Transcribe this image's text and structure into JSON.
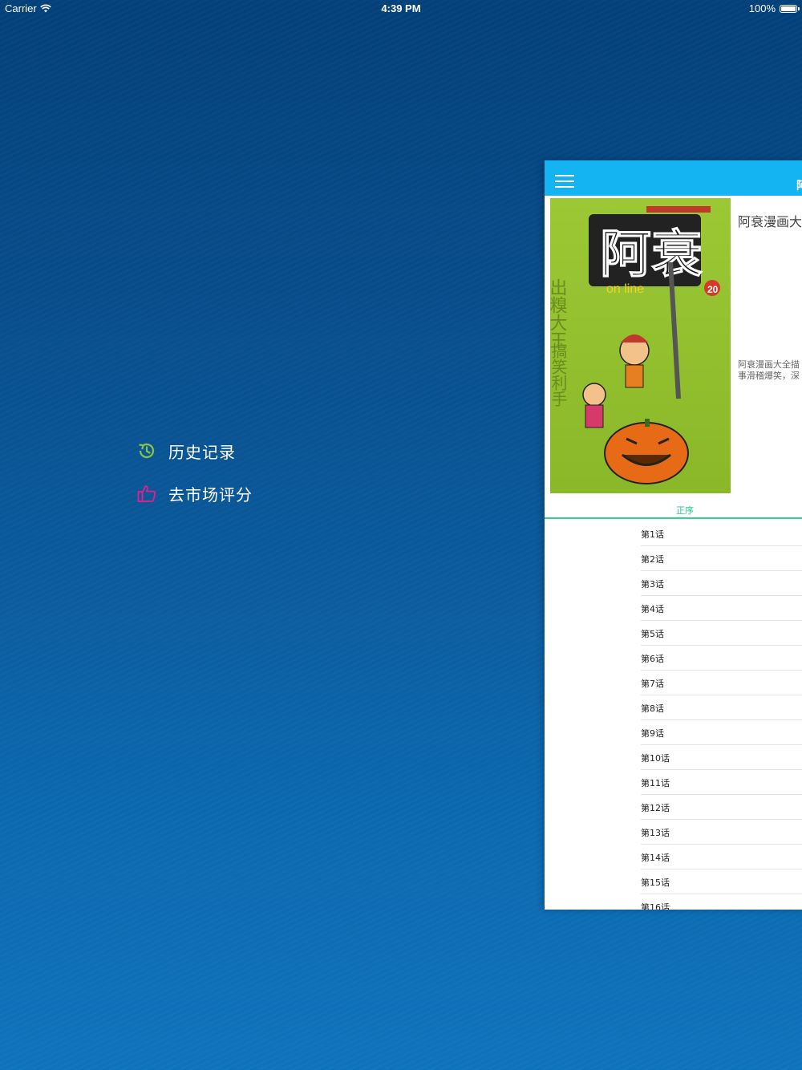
{
  "status_bar": {
    "carrier": "Carrier",
    "time": "4:39 PM",
    "battery": "100%",
    "battery_level": 1.0
  },
  "side_menu": {
    "items": [
      {
        "label": "历史记录",
        "icon": "history-icon",
        "color": "#8bc34a"
      },
      {
        "label": "去市场评分",
        "icon": "thumbs-up-icon",
        "color": "#e91e8c"
      }
    ]
  },
  "panel": {
    "nav_title": "阿",
    "info": {
      "title": "阿衰漫画大",
      "description_line1": "阿衰漫画大全描",
      "description_line2": "事滑稽爆笑，深"
    },
    "sort_label": "正序",
    "chapters": [
      "第1话",
      "第2话",
      "第3话",
      "第4话",
      "第5话",
      "第6话",
      "第7话",
      "第8话",
      "第9话",
      "第10话",
      "第11话",
      "第12话",
      "第13话",
      "第14话",
      "第15话",
      "第16话"
    ],
    "cover": {
      "title": "阿衰",
      "subtitle": "on line",
      "volume": "20"
    }
  },
  "colors": {
    "navbar": "#14b4f3",
    "sort_accent": "#22c98a"
  }
}
